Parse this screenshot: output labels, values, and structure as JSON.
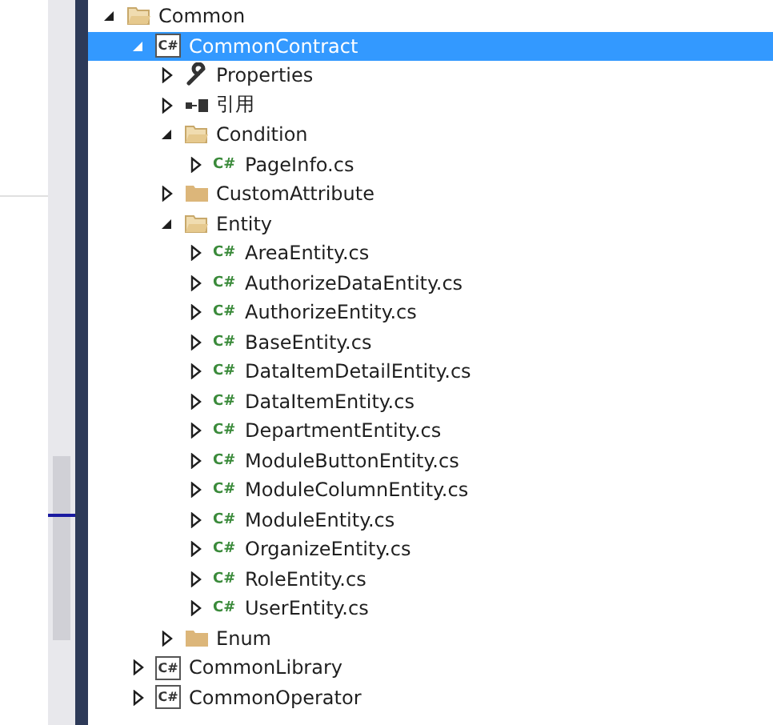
{
  "tree": [
    {
      "kind": "folder",
      "label": "Common",
      "expanded": true,
      "selected": false,
      "children": [
        {
          "kind": "project",
          "badge": "C#",
          "label": "CommonContract",
          "expanded": true,
          "selected": true,
          "children": [
            {
              "kind": "properties",
              "label": "Properties",
              "expanded": false,
              "selected": false
            },
            {
              "kind": "references",
              "label": "引用",
              "expanded": false,
              "selected": false
            },
            {
              "kind": "folder",
              "label": "Condition",
              "expanded": true,
              "selected": false,
              "children": [
                {
                  "kind": "cs",
                  "badge": "C#",
                  "label": "PageInfo.cs",
                  "expanded": false,
                  "selected": false
                }
              ]
            },
            {
              "kind": "folder",
              "label": "CustomAttribute",
              "expanded": false,
              "selected": false
            },
            {
              "kind": "folder",
              "label": "Entity",
              "expanded": true,
              "selected": false,
              "children": [
                {
                  "kind": "cs",
                  "badge": "C#",
                  "label": "AreaEntity.cs",
                  "expanded": false,
                  "selected": false
                },
                {
                  "kind": "cs",
                  "badge": "C#",
                  "label": "AuthorizeDataEntity.cs",
                  "expanded": false,
                  "selected": false
                },
                {
                  "kind": "cs",
                  "badge": "C#",
                  "label": "AuthorizeEntity.cs",
                  "expanded": false,
                  "selected": false
                },
                {
                  "kind": "cs",
                  "badge": "C#",
                  "label": "BaseEntity.cs",
                  "expanded": false,
                  "selected": false
                },
                {
                  "kind": "cs",
                  "badge": "C#",
                  "label": "DataItemDetailEntity.cs",
                  "expanded": false,
                  "selected": false
                },
                {
                  "kind": "cs",
                  "badge": "C#",
                  "label": "DataItemEntity.cs",
                  "expanded": false,
                  "selected": false
                },
                {
                  "kind": "cs",
                  "badge": "C#",
                  "label": "DepartmentEntity.cs",
                  "expanded": false,
                  "selected": false
                },
                {
                  "kind": "cs",
                  "badge": "C#",
                  "label": "ModuleButtonEntity.cs",
                  "expanded": false,
                  "selected": false
                },
                {
                  "kind": "cs",
                  "badge": "C#",
                  "label": "ModuleColumnEntity.cs",
                  "expanded": false,
                  "selected": false
                },
                {
                  "kind": "cs",
                  "badge": "C#",
                  "label": "ModuleEntity.cs",
                  "expanded": false,
                  "selected": false
                },
                {
                  "kind": "cs",
                  "badge": "C#",
                  "label": "OrganizeEntity.cs",
                  "expanded": false,
                  "selected": false
                },
                {
                  "kind": "cs",
                  "badge": "C#",
                  "label": "RoleEntity.cs",
                  "expanded": false,
                  "selected": false
                },
                {
                  "kind": "cs",
                  "badge": "C#",
                  "label": "UserEntity.cs",
                  "expanded": false,
                  "selected": false
                }
              ]
            },
            {
              "kind": "folder",
              "label": "Enum",
              "expanded": false,
              "selected": false
            }
          ]
        },
        {
          "kind": "project",
          "badge": "C#",
          "label": "CommonLibrary",
          "expanded": false,
          "selected": false
        },
        {
          "kind": "project",
          "badge": "C#",
          "label": "CommonOperator",
          "expanded": false,
          "selected": false
        }
      ]
    }
  ]
}
